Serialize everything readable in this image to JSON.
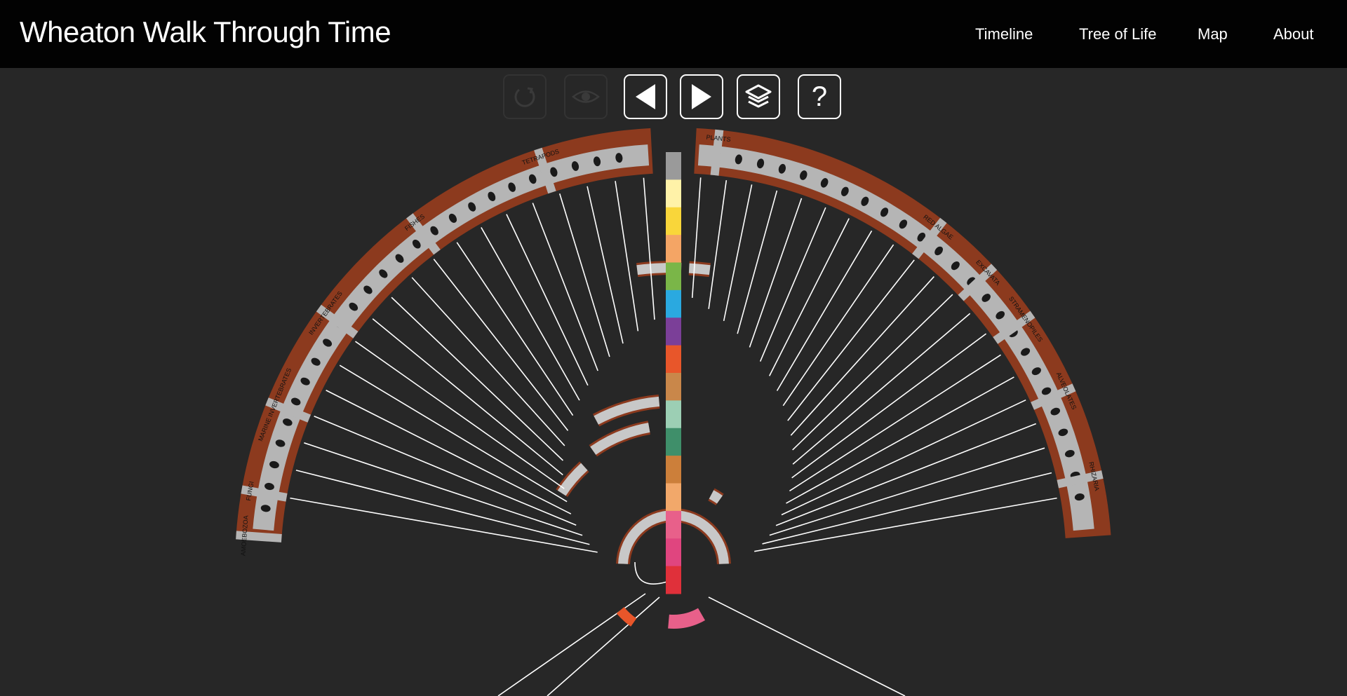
{
  "header": {
    "title": "Wheaton Walk Through Time",
    "nav": [
      {
        "label": "Timeline"
      },
      {
        "label": "Tree of Life"
      },
      {
        "label": "Map"
      },
      {
        "label": "About"
      }
    ]
  },
  "toolbar": {
    "buttons": [
      {
        "icon": "reset-icon",
        "enabled": false
      },
      {
        "icon": "eye-icon",
        "enabled": false
      },
      {
        "icon": "arrow-left-icon",
        "enabled": true
      },
      {
        "icon": "arrow-right-icon",
        "enabled": true
      },
      {
        "icon": "layers-icon",
        "enabled": true
      },
      {
        "icon": "help-icon",
        "enabled": true,
        "glyph": "?"
      }
    ]
  },
  "tree": {
    "clades_left": [
      "AMOEBOZOA",
      "FUNGI",
      "MARINE INVERTEBRATES",
      "INVERTEBRATES",
      "FISHES",
      "TETRAPODS"
    ],
    "clades_right": [
      "PLANTS",
      "RED ALGAE",
      "EXCAVATA",
      "STRAMENOPILES",
      "ALVEOLATES",
      "RHIZARIA"
    ],
    "colors": {
      "outer_ring": "#8c3a1e",
      "label_band": "#b5b5b5",
      "branches": "#ffffff",
      "background": "#272727"
    },
    "time_bar_colors": [
      "#9a9a9a",
      "#fff2a8",
      "#f9d63a",
      "#f4a565",
      "#7ab648",
      "#2aa9e0",
      "#7b3f98",
      "#e8562a",
      "#c9874a",
      "#9ccfb4",
      "#3f8f6a",
      "#cc7f3a",
      "#f2a86a",
      "#e8608a",
      "#e0457f",
      "#e0303a"
    ]
  }
}
